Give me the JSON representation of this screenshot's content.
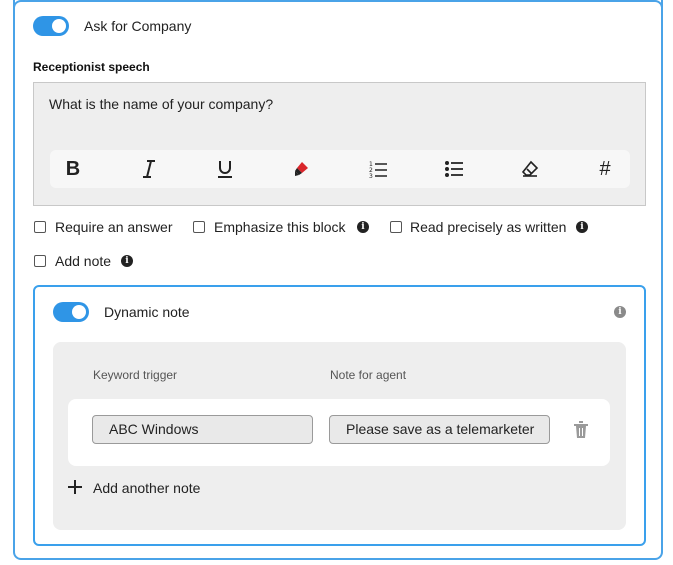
{
  "ask_company": {
    "label": "Ask for Company",
    "enabled": true
  },
  "speech": {
    "label": "Receptionist speech",
    "text": "What is the name of your company?"
  },
  "toolbar": {
    "buttons": [
      "bold-icon",
      "italic-icon",
      "underline-icon",
      "highlighter-icon",
      "numbered-list-icon",
      "bullet-list-icon",
      "eraser-icon",
      "hashtag-icon"
    ]
  },
  "options": {
    "require_answer": "Require an answer",
    "emphasize": "Emphasize this block",
    "read_precisely": "Read precisely as written",
    "add_note": "Add note"
  },
  "dynamic_note": {
    "label": "Dynamic note",
    "enabled": true,
    "col_keyword": "Keyword trigger",
    "col_note": "Note for agent",
    "rows": [
      {
        "keyword": "ABC Windows",
        "note": "Please save as a telemarketer"
      }
    ],
    "add_label": "Add another note"
  },
  "colors": {
    "accent": "#2f95e6",
    "border": "#4aa3e8"
  }
}
